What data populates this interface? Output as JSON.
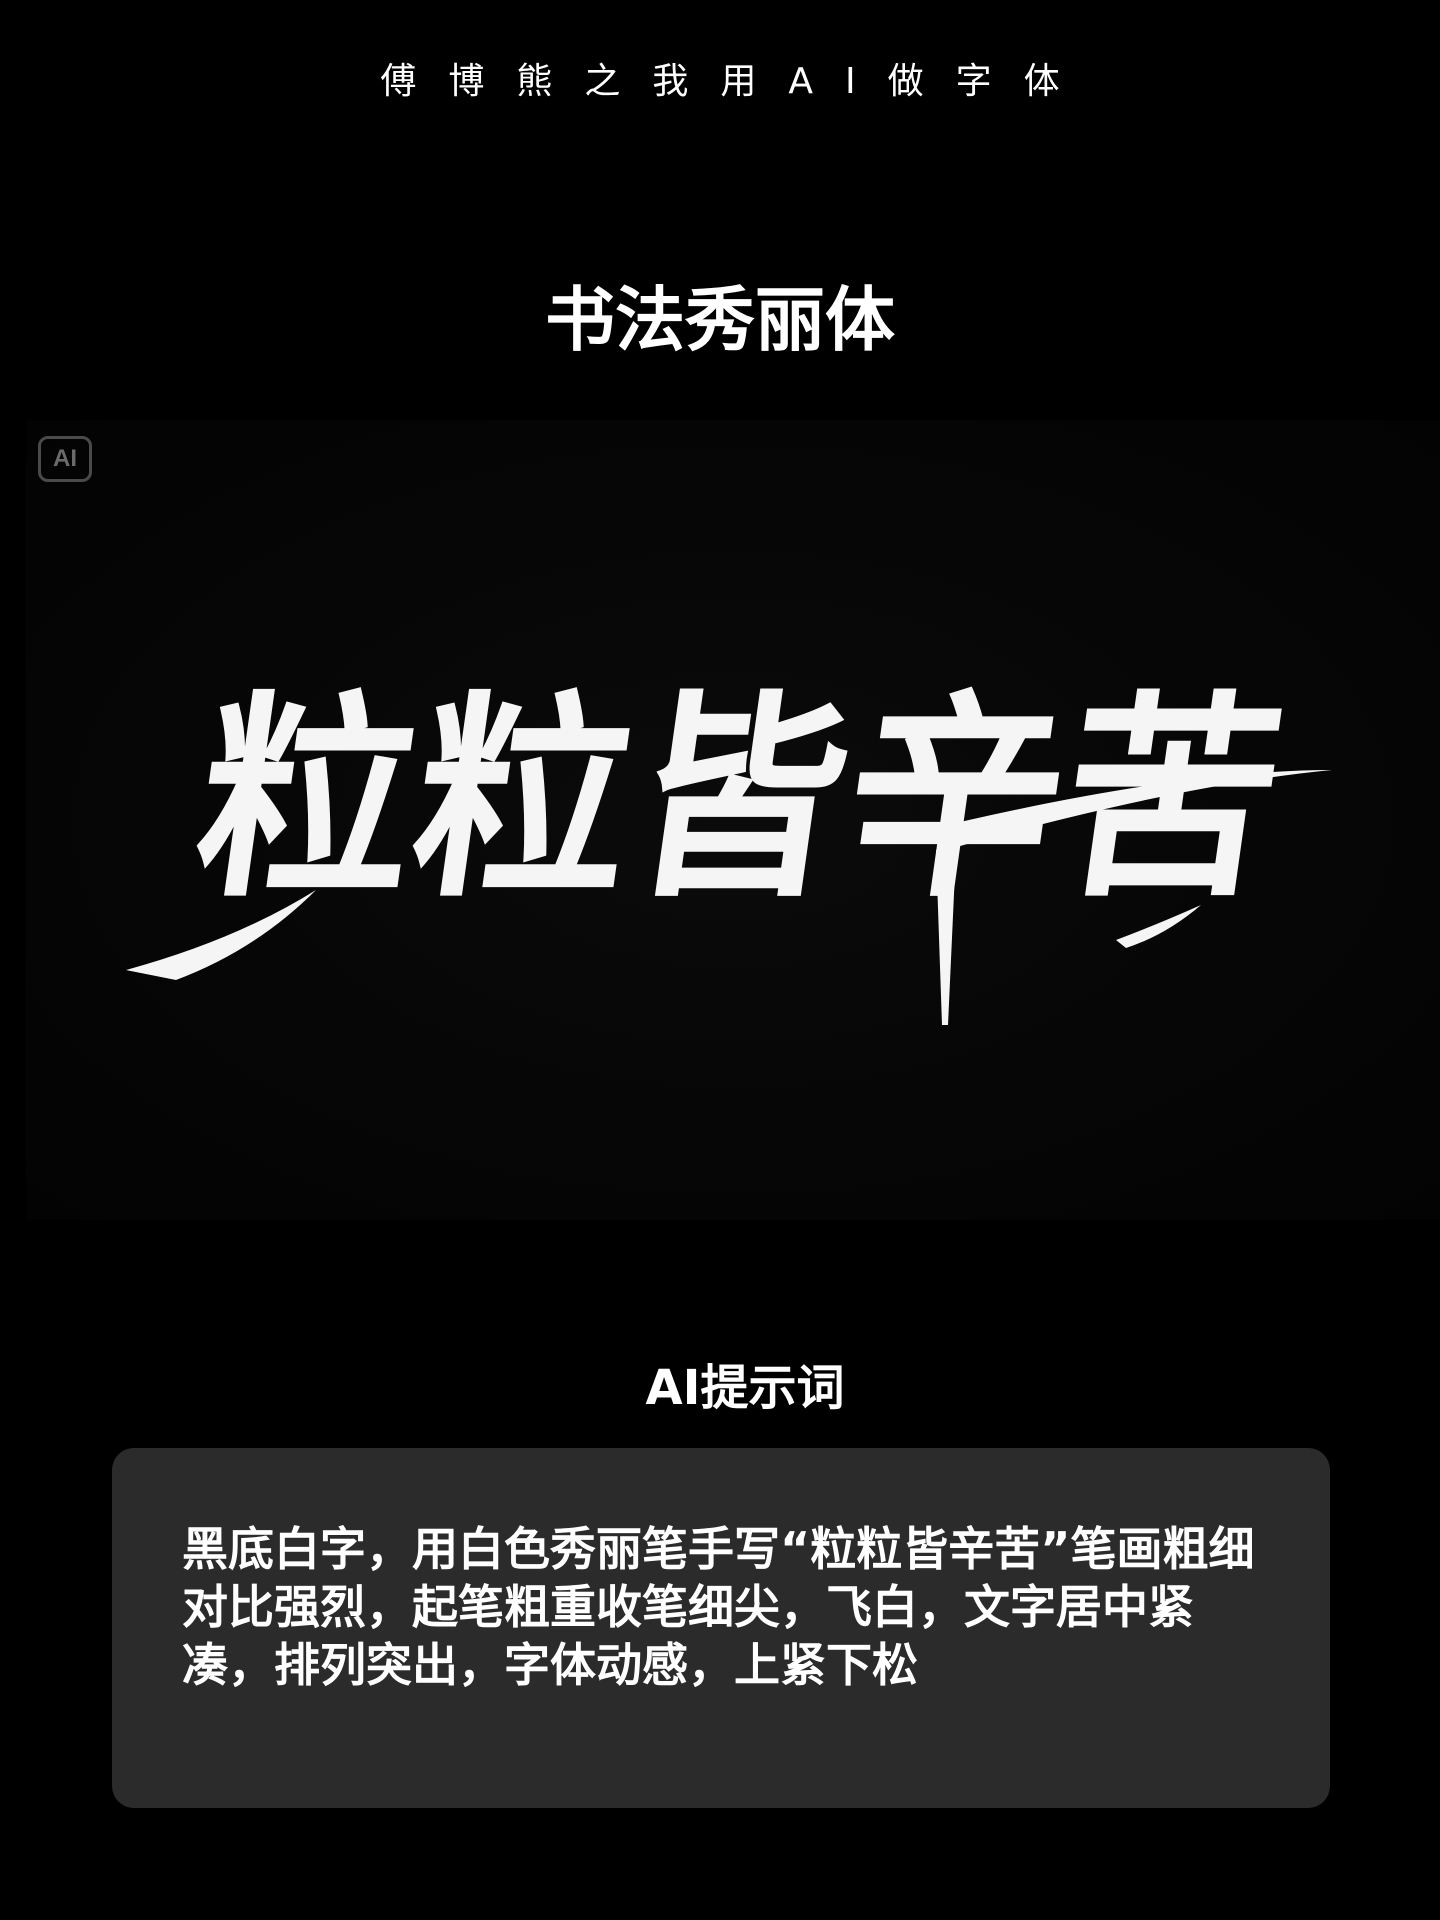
{
  "header": {
    "series_title": "傅博熊之我用AI做字体"
  },
  "section": {
    "title": "书法秀丽体"
  },
  "artwork": {
    "badge_label": "AI",
    "calligraphy_text": "粒粒皆辛苦",
    "stroke_color": "#f5f5f5",
    "background_color": "#000000"
  },
  "prompt": {
    "heading": "AI提示词",
    "text": "黑底白字，用白色秀丽笔手写“粒粒皆辛苦”笔画粗细对比强烈，起笔粗重收笔细尖，飞白，文字居中紧凑，排列突出，字体动感，上紧下松",
    "card_color": "#2b2b2b"
  }
}
